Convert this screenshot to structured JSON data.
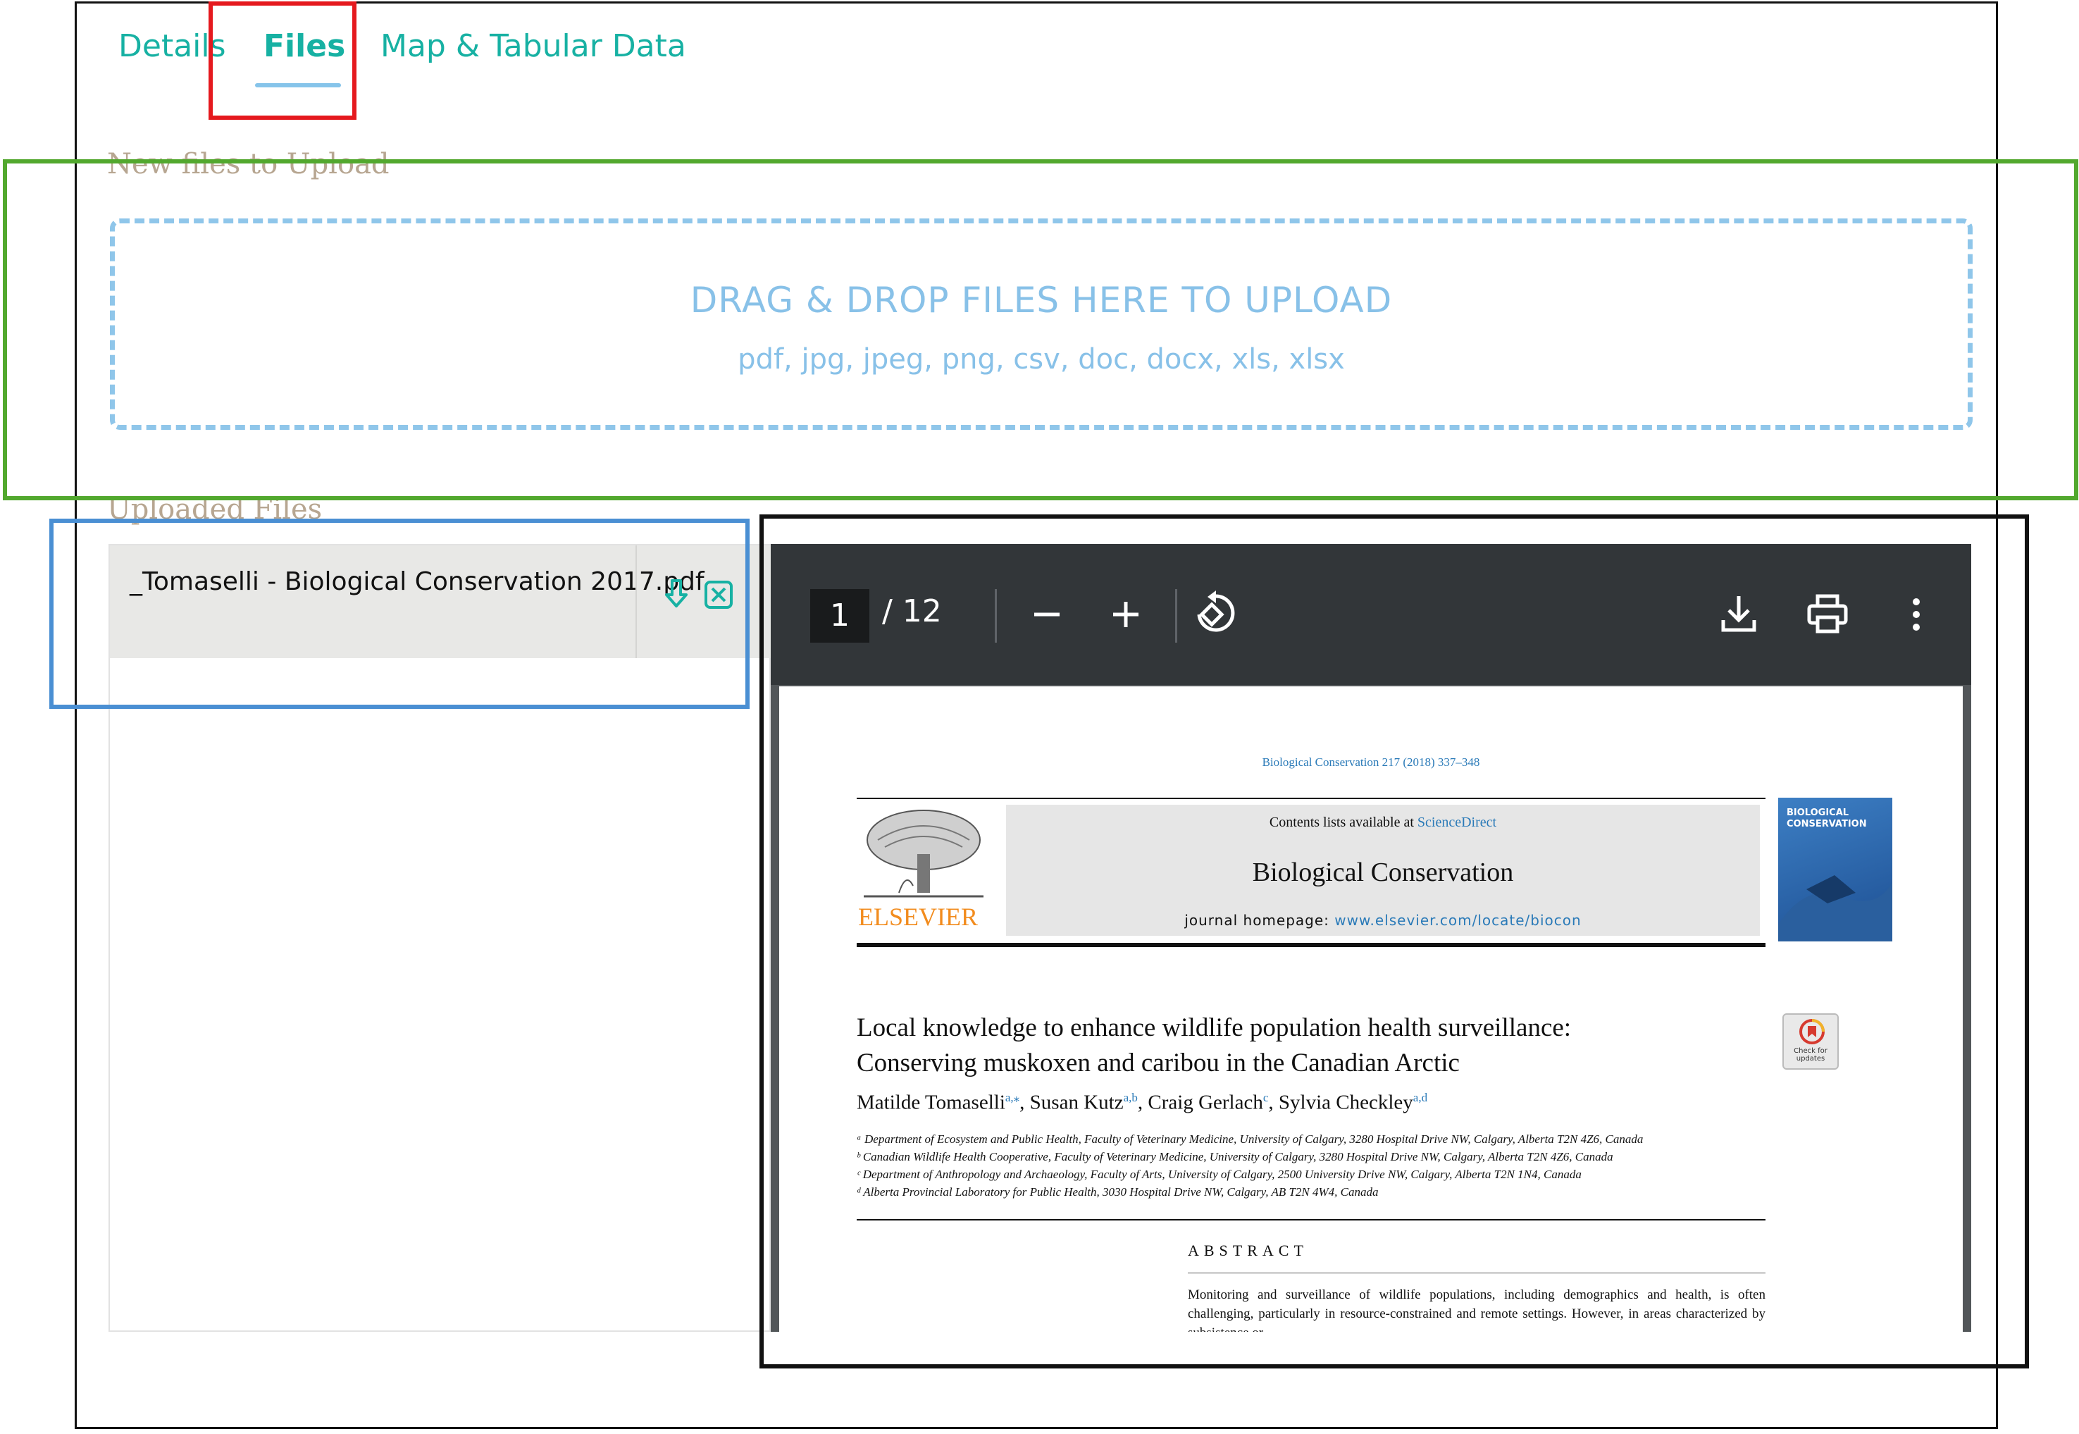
{
  "tabs": [
    {
      "label": "Details"
    },
    {
      "label": "Files"
    },
    {
      "label": "Map & Tabular Data"
    }
  ],
  "active_tab": "Files",
  "upload": {
    "section_label": "New files to Upload",
    "dropzone_title": "DRAG & DROP FILES HERE TO UPLOAD",
    "dropzone_types": "pdf, jpg, jpeg, png, csv, doc, docx, xls, xlsx"
  },
  "uploaded": {
    "section_label": "Uploaded Files",
    "files": [
      {
        "name": "_Tomaselli - Biological Conservation 2017.pdf"
      }
    ]
  },
  "viewer": {
    "current_page": "1",
    "total_pages": "/ 12",
    "icons": [
      "zoom-out-icon",
      "zoom-in-icon",
      "rotate-icon",
      "download-icon",
      "print-icon",
      "more-vert-icon"
    ]
  },
  "document": {
    "journal_ref": "Biological Conservation 217 (2018) 337–348",
    "contents_prefix": "Contents lists available at ",
    "contents_link": "ScienceDirect",
    "journal_title": "Biological Conservation",
    "homepage_prefix": "journal homepage: ",
    "homepage_url": "www.elsevier.com/locate/biocon",
    "publisher": "ELSEVIER",
    "cover_title_1": "BIOLOGICAL",
    "cover_title_2": "CONSERVATION",
    "check_updates_1": "Check for",
    "check_updates_2": "updates",
    "title_line_1": "Local knowledge to enhance wildlife population health surveillance:",
    "title_line_2": "Conserving muskoxen and caribou in the Canadian Arctic",
    "authors": [
      {
        "name": "Matilde Tomaselli",
        "sup": "a,⁎",
        "sep": ", "
      },
      {
        "name": "Susan Kutz",
        "sup": "a,b",
        "sep": ", "
      },
      {
        "name": "Craig Gerlach",
        "sup": "c",
        "sep": ", "
      },
      {
        "name": "Sylvia Checkley",
        "sup": "a,d",
        "sep": ""
      }
    ],
    "affiliations": [
      "ᵃ Department of Ecosystem and Public Health, Faculty of Veterinary Medicine, University of Calgary, 3280 Hospital Drive NW, Calgary, Alberta T2N 4Z6, Canada",
      "ᵇ Canadian Wildlife Health Cooperative, Faculty of Veterinary Medicine, University of Calgary, 3280 Hospital Drive NW, Calgary, Alberta T2N 4Z6, Canada",
      "ᶜ Department of Anthropology and Archaeology, Faculty of Arts, University of Calgary, 2500 University Drive NW, Calgary, Alberta T2N 1N4, Canada",
      "ᵈ Alberta Provincial Laboratory for Public Health, 3030 Hospital Drive NW, Calgary, AB T2N 4W4, Canada"
    ],
    "abstract_heading": "ABSTRACT",
    "abstract_text": "Monitoring and surveillance of wildlife populations, including demographics and health, is often challenging, particularly in resource-constrained and remote settings. However, in areas characterized by subsistence or-"
  },
  "colors": {
    "tab_text": "#17b1a3",
    "tab_underline": "#86c4ea",
    "dropzone": "#8fc6ea",
    "section_label": "#b7a691",
    "action_icon": "#17b1a3",
    "highlight_red": "#e5191e",
    "highlight_green": "#52a82e",
    "highlight_blue": "#4a8fd3",
    "highlight_black": "#111111"
  }
}
